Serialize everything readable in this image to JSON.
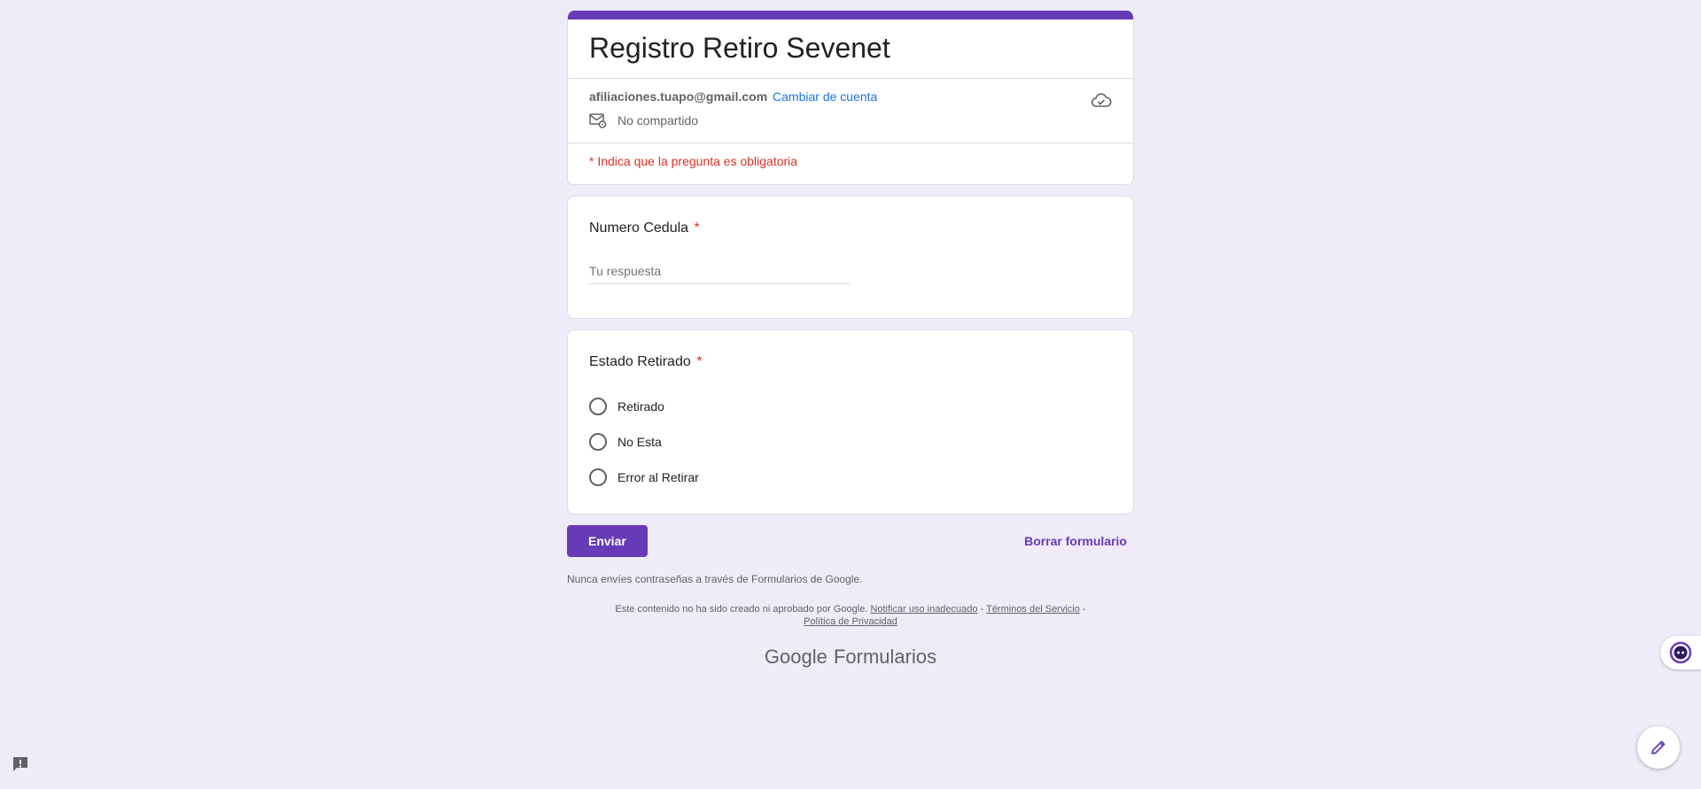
{
  "form": {
    "title": "Registro Retiro Sevenet",
    "account_email": "afiliaciones.tuapo@gmail.com",
    "switch_account": "Cambiar de cuenta",
    "not_shared": "No compartido",
    "required_note": "* Indica que la pregunta es obligatoria"
  },
  "questions": {
    "q1": {
      "title": "Numero Cedula",
      "required_mark": "*",
      "placeholder": "Tu respuesta",
      "value": ""
    },
    "q2": {
      "title": "Estado Retirado",
      "required_mark": "*",
      "options": [
        "Retirado",
        "No Esta",
        "Error al Retirar"
      ]
    }
  },
  "actions": {
    "submit": "Enviar",
    "clear": "Borrar formulario"
  },
  "footer": {
    "password_warning": "Nunca envíes contraseñas a través de Formularios de Google.",
    "disclaimer_text": "Este contenido no ha sido creado ni aprobado por Google.",
    "report_link": "Notificar uso inadecuado",
    "sep1": " - ",
    "terms_link": "Términos del Servicio",
    "sep2": " - ",
    "privacy_link": "Política de Privacidad",
    "brand_google": "Google",
    "brand_product": "Formularios"
  },
  "colors": {
    "accent": "#673ab7",
    "background": "#efebf8",
    "required": "#d93025",
    "link": "#1a73e8"
  }
}
